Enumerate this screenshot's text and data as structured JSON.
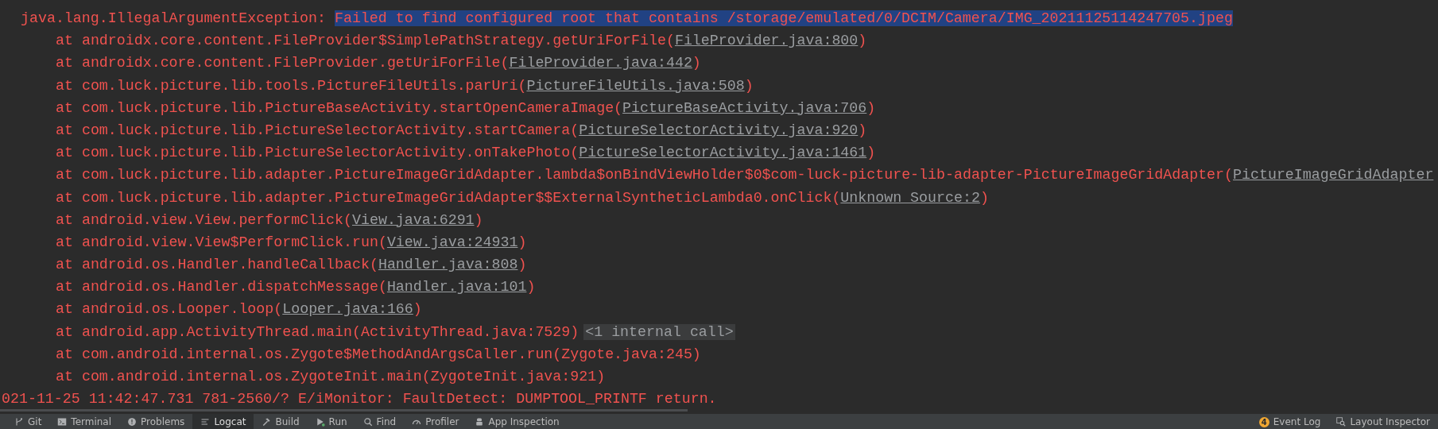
{
  "console": {
    "lines": [
      {
        "kind": "exception",
        "parts": [
          {
            "kind": "plain",
            "text": "java.lang.IllegalArgumentException: "
          },
          {
            "kind": "selected",
            "text": "Failed to find configured root that contains /storage/emulated/0/DCIM/Camera/IMG_20211125114247705.jpeg"
          }
        ]
      },
      {
        "kind": "frame",
        "parts": [
          {
            "kind": "plain",
            "text": "at androidx.core.content.FileProvider$SimplePathStrategy.getUriForFile("
          },
          {
            "kind": "link",
            "text": "FileProvider.java:800"
          },
          {
            "kind": "plain",
            "text": ")"
          }
        ]
      },
      {
        "kind": "frame",
        "parts": [
          {
            "kind": "plain",
            "text": "at androidx.core.content.FileProvider.getUriForFile("
          },
          {
            "kind": "link",
            "text": "FileProvider.java:442"
          },
          {
            "kind": "plain",
            "text": ")"
          }
        ]
      },
      {
        "kind": "frame",
        "parts": [
          {
            "kind": "plain",
            "text": "at com.luck.picture.lib.tools.PictureFileUtils.parUri("
          },
          {
            "kind": "link",
            "text": "PictureFileUtils.java:508"
          },
          {
            "kind": "plain",
            "text": ")"
          }
        ]
      },
      {
        "kind": "frame",
        "parts": [
          {
            "kind": "plain",
            "text": "at com.luck.picture.lib.PictureBaseActivity.startOpenCameraImage("
          },
          {
            "kind": "link",
            "text": "PictureBaseActivity.java:706"
          },
          {
            "kind": "plain",
            "text": ")"
          }
        ]
      },
      {
        "kind": "frame",
        "parts": [
          {
            "kind": "plain",
            "text": "at com.luck.picture.lib.PictureSelectorActivity.startCamera("
          },
          {
            "kind": "link",
            "text": "PictureSelectorActivity.java:920"
          },
          {
            "kind": "plain",
            "text": ")"
          }
        ]
      },
      {
        "kind": "frame",
        "parts": [
          {
            "kind": "plain",
            "text": "at com.luck.picture.lib.PictureSelectorActivity.onTakePhoto("
          },
          {
            "kind": "link",
            "text": "PictureSelectorActivity.java:1461"
          },
          {
            "kind": "plain",
            "text": ")"
          }
        ]
      },
      {
        "kind": "frame",
        "parts": [
          {
            "kind": "plain",
            "text": "at com.luck.picture.lib.adapter.PictureImageGridAdapter.lambda$onBindViewHolder$0$com-luck-picture-lib-adapter-PictureImageGridAdapter("
          },
          {
            "kind": "link",
            "text": "PictureImageGridAdapter"
          }
        ]
      },
      {
        "kind": "frame",
        "parts": [
          {
            "kind": "plain",
            "text": "at com.luck.picture.lib.adapter.PictureImageGridAdapter$$ExternalSyntheticLambda0.onClick("
          },
          {
            "kind": "link",
            "text": "Unknown Source:2"
          },
          {
            "kind": "plain",
            "text": ")"
          }
        ]
      },
      {
        "kind": "frame",
        "parts": [
          {
            "kind": "plain",
            "text": "at android.view.View.performClick("
          },
          {
            "kind": "link",
            "text": "View.java:6291"
          },
          {
            "kind": "plain",
            "text": ")"
          }
        ]
      },
      {
        "kind": "frame",
        "parts": [
          {
            "kind": "plain",
            "text": "at android.view.View$PerformClick.run("
          },
          {
            "kind": "link",
            "text": "View.java:24931"
          },
          {
            "kind": "plain",
            "text": ")"
          }
        ]
      },
      {
        "kind": "frame",
        "parts": [
          {
            "kind": "plain",
            "text": "at android.os.Handler.handleCallback("
          },
          {
            "kind": "link",
            "text": "Handler.java:808"
          },
          {
            "kind": "plain",
            "text": ")"
          }
        ]
      },
      {
        "kind": "frame",
        "parts": [
          {
            "kind": "plain",
            "text": "at android.os.Handler.dispatchMessage("
          },
          {
            "kind": "link",
            "text": "Handler.java:101"
          },
          {
            "kind": "plain",
            "text": ")"
          }
        ]
      },
      {
        "kind": "frame",
        "parts": [
          {
            "kind": "plain",
            "text": "at android.os.Looper.loop("
          },
          {
            "kind": "link",
            "text": "Looper.java:166"
          },
          {
            "kind": "plain",
            "text": ")"
          }
        ]
      },
      {
        "kind": "frame",
        "parts": [
          {
            "kind": "plain",
            "text": "at android.app.ActivityThread.main(ActivityThread.java:7529)"
          },
          {
            "kind": "folded",
            "text": "<1 internal call>"
          }
        ]
      },
      {
        "kind": "frame",
        "parts": [
          {
            "kind": "plain",
            "text": "at com.android.internal.os.Zygote$MethodAndArgsCaller.run(Zygote.java:245)"
          }
        ]
      },
      {
        "kind": "frame",
        "parts": [
          {
            "kind": "plain",
            "text": "at com.android.internal.os.ZygoteInit.main(ZygoteInit.java:921)"
          }
        ]
      },
      {
        "kind": "log",
        "parts": [
          {
            "kind": "plain",
            "text": "021-11-25 11:42:47.731 781-2560/? E/iMonitor: FaultDetect: DUMPTOOL_PRINTF return."
          }
        ]
      }
    ]
  },
  "tool_tabs": [
    {
      "label": "Git",
      "selected": false
    },
    {
      "label": "Terminal",
      "selected": false
    },
    {
      "label": "Problems",
      "selected": false
    },
    {
      "label": "Logcat",
      "selected": true
    },
    {
      "label": "Build",
      "selected": false
    },
    {
      "label": "Run",
      "selected": false
    },
    {
      "label": "Find",
      "selected": false
    },
    {
      "label": "Profiler",
      "selected": false
    },
    {
      "label": "App Inspection",
      "selected": false
    }
  ],
  "right_tabs": [
    {
      "label": "Event Log",
      "badge": "4"
    },
    {
      "label": "Layout Inspector"
    }
  ]
}
